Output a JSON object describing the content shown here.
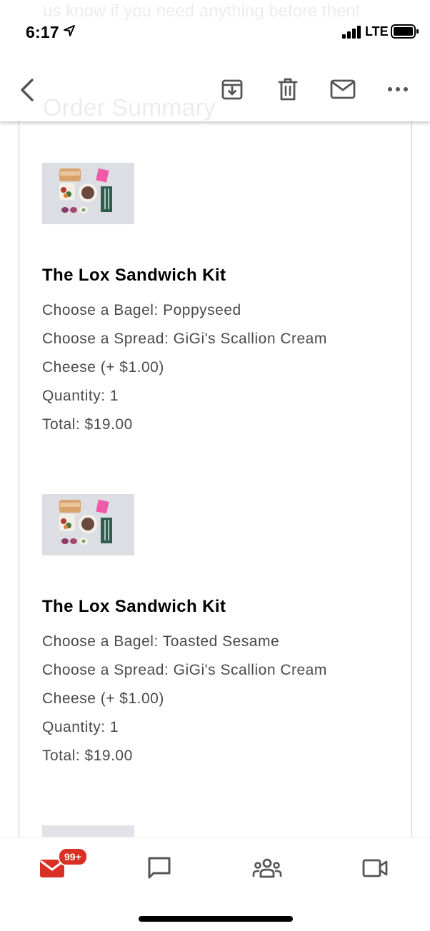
{
  "status_bar": {
    "time": "6:17",
    "network": "LTE"
  },
  "background": {
    "preview_text": "us know if you need anything before then!",
    "section_heading": "Order Summary"
  },
  "toolbar": {
    "back_icon": "chevron-left-icon",
    "archive_icon": "archive-icon",
    "delete_icon": "trash-icon",
    "mark_unread_icon": "mail-icon",
    "more_icon": "more-horizontal-icon"
  },
  "order_items": [
    {
      "title": "The Lox Sandwich Kit",
      "bagel": "Choose a Bagel: Poppyseed",
      "spread_line1": "Choose a Spread: GiGi's Scallion Cream",
      "spread_line2": "Cheese (+ $1.00)",
      "quantity": "Quantity: 1",
      "total": "Total: $19.00"
    },
    {
      "title": "The Lox Sandwich Kit",
      "bagel": "Choose a Bagel: Toasted Sesame",
      "spread_line1": "Choose a Spread: GiGi's Scallion Cream",
      "spread_line2": "Cheese (+ $1.00)",
      "quantity": "Quantity: 1",
      "total": "Total: $19.00"
    }
  ],
  "bottom_nav": {
    "mail_badge": "99+",
    "accent_color": "#d93025",
    "icons": [
      "mail-icon",
      "chat-icon",
      "rooms-icon",
      "meet-icon"
    ]
  }
}
